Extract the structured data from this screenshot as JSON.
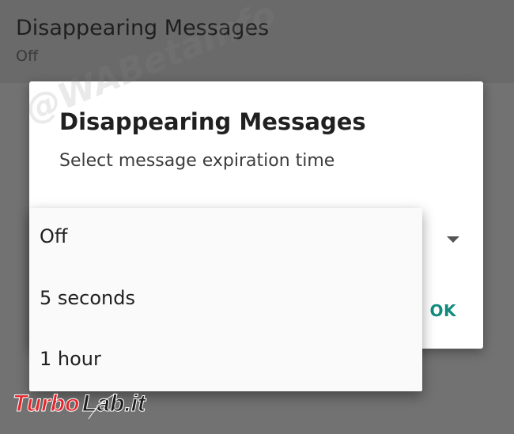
{
  "background_setting": {
    "title": "Disappearing Messages",
    "value": "Off"
  },
  "dialog": {
    "title": "Disappearing Messages",
    "message": "Select message expiration time",
    "ok_label": "OK",
    "dropdown_icon": "arrow-drop-down-icon"
  },
  "menu": {
    "items": [
      {
        "label": "Off"
      },
      {
        "label": "5 seconds"
      },
      {
        "label": "1 hour"
      }
    ]
  },
  "watermarks": {
    "wabetainfo": "@WABetaInfo",
    "turbolab": "TurboLab.it"
  },
  "colors": {
    "accent": "#128c7e",
    "scrim": "#6e6e6e",
    "dialog_bg": "#ffffff",
    "menu_bg": "#fafafa",
    "turbolab_red": "#e3262b"
  }
}
